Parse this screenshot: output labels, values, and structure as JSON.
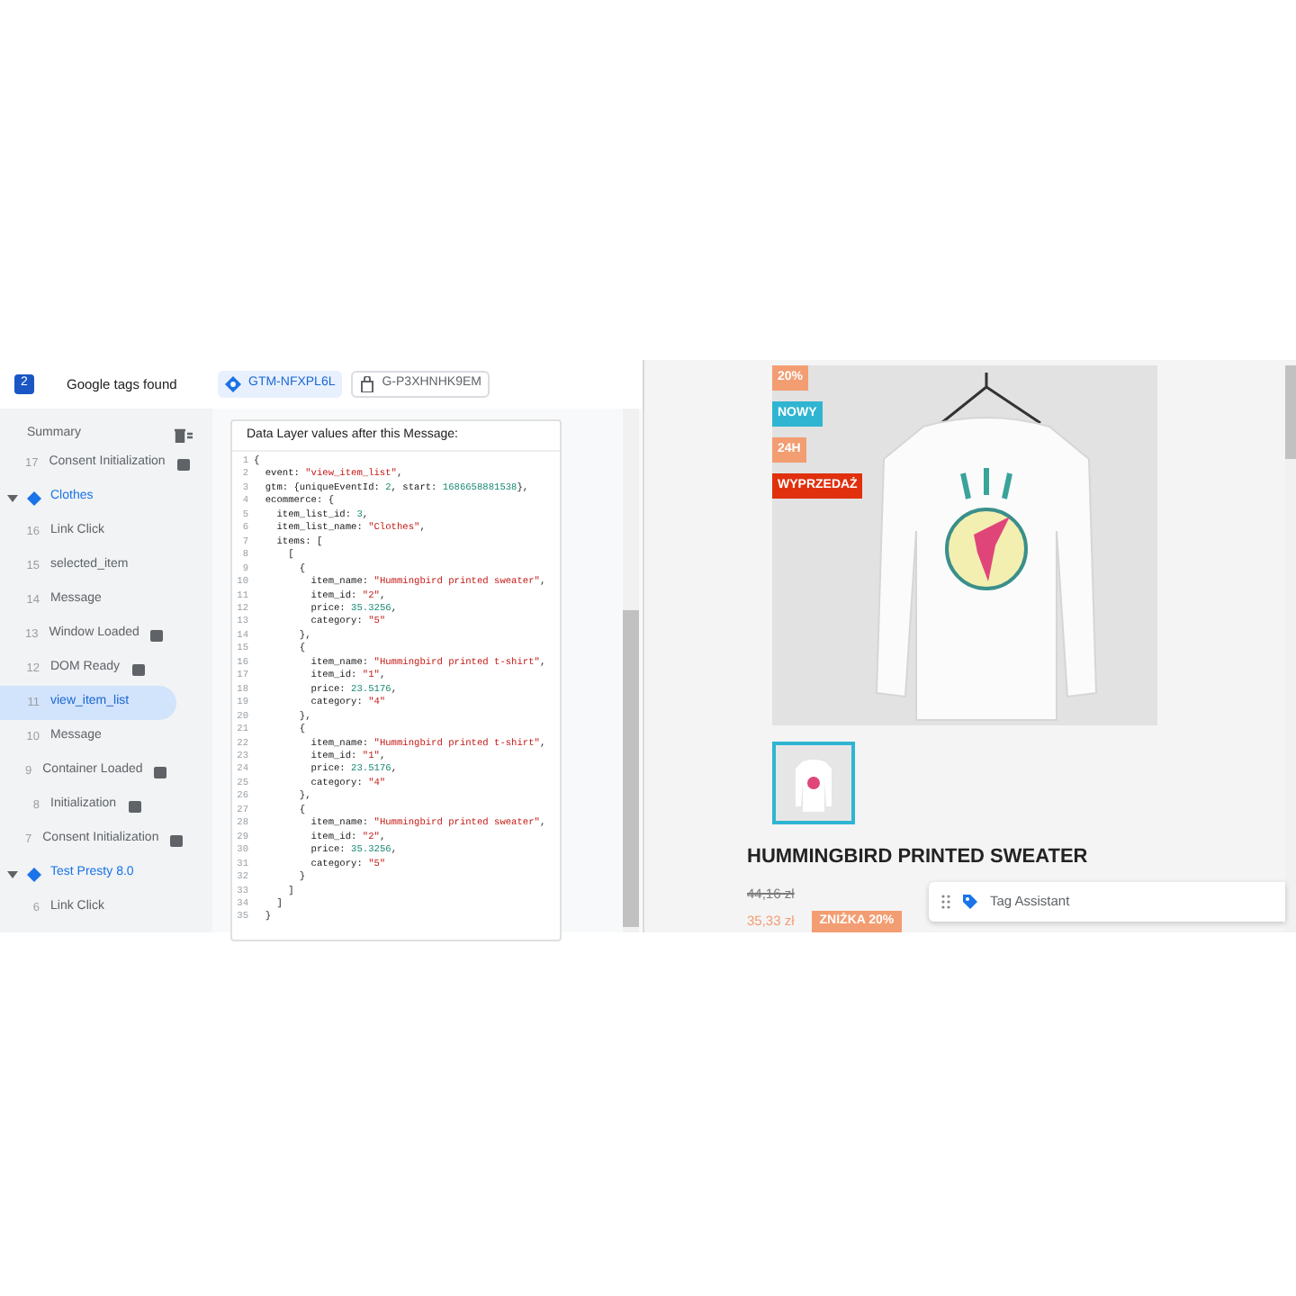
{
  "header": {
    "count": "2",
    "title": "Google tags found",
    "tabs": [
      {
        "label": "GTM-NFXPL6L",
        "kind": "gtm",
        "selected": true
      },
      {
        "label": "G-P3XHNHK9EM",
        "kind": "ga",
        "selected": false
      }
    ]
  },
  "sidebar": {
    "title": "Summary",
    "items": [
      {
        "kind": "event",
        "num": "17",
        "label": "Consent Initialization",
        "has_icon": true,
        "selected": false
      },
      {
        "kind": "page",
        "label": "Clothes",
        "expanded": true,
        "children": [
          {
            "kind": "event",
            "num": "16",
            "label": "Link Click",
            "has_icon": false,
            "selected": false
          },
          {
            "kind": "event",
            "num": "15",
            "label": "selected_item",
            "has_icon": false,
            "selected": false
          },
          {
            "kind": "event",
            "num": "14",
            "label": "Message",
            "has_icon": false,
            "selected": false
          },
          {
            "kind": "event",
            "num": "13",
            "label": "Window Loaded",
            "has_icon": true,
            "selected": false
          },
          {
            "kind": "event",
            "num": "12",
            "label": "DOM Ready",
            "has_icon": true,
            "selected": false
          },
          {
            "kind": "event",
            "num": "11",
            "label": "view_item_list",
            "has_icon": false,
            "selected": true
          },
          {
            "kind": "event",
            "num": "10",
            "label": "Message",
            "has_icon": false,
            "selected": false
          },
          {
            "kind": "event",
            "num": "9",
            "label": "Container Loaded",
            "has_icon": true,
            "selected": false
          },
          {
            "kind": "event",
            "num": "8",
            "label": "Initialization",
            "has_icon": true,
            "selected": false
          },
          {
            "kind": "event",
            "num": "7",
            "label": "Consent Initialization",
            "has_icon": true,
            "selected": false
          }
        ]
      },
      {
        "kind": "page",
        "label": "Test Presty 8.0",
        "expanded": true,
        "children": [
          {
            "kind": "event",
            "num": "6",
            "label": "Link Click",
            "has_icon": false,
            "selected": false
          }
        ]
      }
    ]
  },
  "data_layer": {
    "title": "Data Layer values after this Message:",
    "lines": [
      {
        "num": "1",
        "parts": [
          {
            "kind": "plain",
            "text": "{"
          }
        ]
      },
      {
        "num": "2",
        "parts": [
          {
            "kind": "plain",
            "text": "  event: "
          },
          {
            "kind": "string",
            "text": "\"view_item_list\""
          },
          {
            "kind": "plain",
            "text": ","
          }
        ]
      },
      {
        "num": "3",
        "parts": [
          {
            "kind": "plain",
            "text": "  gtm: {uniqueEventId: "
          },
          {
            "kind": "number",
            "text": "2"
          },
          {
            "kind": "plain",
            "text": ", start: "
          },
          {
            "kind": "number",
            "text": "1686658881538"
          },
          {
            "kind": "plain",
            "text": "},"
          }
        ]
      },
      {
        "num": "4",
        "parts": [
          {
            "kind": "plain",
            "text": "  ecommerce: {"
          }
        ]
      },
      {
        "num": "5",
        "parts": [
          {
            "kind": "plain",
            "text": "    item_list_id: "
          },
          {
            "kind": "number",
            "text": "3"
          },
          {
            "kind": "plain",
            "text": ","
          }
        ]
      },
      {
        "num": "6",
        "parts": [
          {
            "kind": "plain",
            "text": "    item_list_name: "
          },
          {
            "kind": "string",
            "text": "\"Clothes\""
          },
          {
            "kind": "plain",
            "text": ","
          }
        ]
      },
      {
        "num": "7",
        "parts": [
          {
            "kind": "plain",
            "text": "    items: ["
          }
        ]
      },
      {
        "num": "8",
        "parts": [
          {
            "kind": "plain",
            "text": "      ["
          }
        ]
      },
      {
        "num": "9",
        "parts": [
          {
            "kind": "plain",
            "text": "        {"
          }
        ]
      },
      {
        "num": "10",
        "parts": [
          {
            "kind": "plain",
            "text": "          item_name: "
          },
          {
            "kind": "string",
            "text": "\"Hummingbird printed sweater\""
          },
          {
            "kind": "plain",
            "text": ","
          }
        ]
      },
      {
        "num": "11",
        "parts": [
          {
            "kind": "plain",
            "text": "          item_id: "
          },
          {
            "kind": "string",
            "text": "\"2\""
          },
          {
            "kind": "plain",
            "text": ","
          }
        ]
      },
      {
        "num": "12",
        "parts": [
          {
            "kind": "plain",
            "text": "          price: "
          },
          {
            "kind": "number",
            "text": "35.3256"
          },
          {
            "kind": "plain",
            "text": ","
          }
        ]
      },
      {
        "num": "13",
        "parts": [
          {
            "kind": "plain",
            "text": "          category: "
          },
          {
            "kind": "string",
            "text": "\"5\""
          }
        ]
      },
      {
        "num": "14",
        "parts": [
          {
            "kind": "plain",
            "text": "        },"
          }
        ]
      },
      {
        "num": "15",
        "parts": [
          {
            "kind": "plain",
            "text": "        {"
          }
        ]
      },
      {
        "num": "16",
        "parts": [
          {
            "kind": "plain",
            "text": "          item_name: "
          },
          {
            "kind": "string",
            "text": "\"Hummingbird printed t-shirt\""
          },
          {
            "kind": "plain",
            "text": ","
          }
        ]
      },
      {
        "num": "17",
        "parts": [
          {
            "kind": "plain",
            "text": "          item_id: "
          },
          {
            "kind": "string",
            "text": "\"1\""
          },
          {
            "kind": "plain",
            "text": ","
          }
        ]
      },
      {
        "num": "18",
        "parts": [
          {
            "kind": "plain",
            "text": "          price: "
          },
          {
            "kind": "number",
            "text": "23.5176"
          },
          {
            "kind": "plain",
            "text": ","
          }
        ]
      },
      {
        "num": "19",
        "parts": [
          {
            "kind": "plain",
            "text": "          category: "
          },
          {
            "kind": "string",
            "text": "\"4\""
          }
        ]
      },
      {
        "num": "20",
        "parts": [
          {
            "kind": "plain",
            "text": "        },"
          }
        ]
      },
      {
        "num": "21",
        "parts": [
          {
            "kind": "plain",
            "text": "        {"
          }
        ]
      },
      {
        "num": "22",
        "parts": [
          {
            "kind": "plain",
            "text": "          item_name: "
          },
          {
            "kind": "string",
            "text": "\"Hummingbird printed t-shirt\""
          },
          {
            "kind": "plain",
            "text": ","
          }
        ]
      },
      {
        "num": "23",
        "parts": [
          {
            "kind": "plain",
            "text": "          item_id: "
          },
          {
            "kind": "string",
            "text": "\"1\""
          },
          {
            "kind": "plain",
            "text": ","
          }
        ]
      },
      {
        "num": "24",
        "parts": [
          {
            "kind": "plain",
            "text": "          price: "
          },
          {
            "kind": "number",
            "text": "23.5176"
          },
          {
            "kind": "plain",
            "text": ","
          }
        ]
      },
      {
        "num": "25",
        "parts": [
          {
            "kind": "plain",
            "text": "          category: "
          },
          {
            "kind": "string",
            "text": "\"4\""
          }
        ]
      },
      {
        "num": "26",
        "parts": [
          {
            "kind": "plain",
            "text": "        },"
          }
        ]
      },
      {
        "num": "27",
        "parts": [
          {
            "kind": "plain",
            "text": "        {"
          }
        ]
      },
      {
        "num": "28",
        "parts": [
          {
            "kind": "plain",
            "text": "          item_name: "
          },
          {
            "kind": "string",
            "text": "\"Hummingbird printed sweater\""
          },
          {
            "kind": "plain",
            "text": ","
          }
        ]
      },
      {
        "num": "29",
        "parts": [
          {
            "kind": "plain",
            "text": "          item_id: "
          },
          {
            "kind": "string",
            "text": "\"2\""
          },
          {
            "kind": "plain",
            "text": ","
          }
        ]
      },
      {
        "num": "30",
        "parts": [
          {
            "kind": "plain",
            "text": "          price: "
          },
          {
            "kind": "number",
            "text": "35.3256"
          },
          {
            "kind": "plain",
            "text": ","
          }
        ]
      },
      {
        "num": "31",
        "parts": [
          {
            "kind": "plain",
            "text": "          category: "
          },
          {
            "kind": "string",
            "text": "\"5\""
          }
        ]
      },
      {
        "num": "32",
        "parts": [
          {
            "kind": "plain",
            "text": "        }"
          }
        ]
      },
      {
        "num": "33",
        "parts": [
          {
            "kind": "plain",
            "text": "      ]"
          }
        ]
      },
      {
        "num": "34",
        "parts": [
          {
            "kind": "plain",
            "text": "    ]"
          }
        ]
      },
      {
        "num": "35",
        "parts": [
          {
            "kind": "plain",
            "text": "  }"
          }
        ]
      }
    ]
  },
  "product": {
    "badges": [
      {
        "label": "20%",
        "color": "#f39d72"
      },
      {
        "label": "NOWY",
        "color": "#2fb5d2"
      },
      {
        "label": "24H",
        "color": "#f39d72"
      },
      {
        "label": "WYPRZEDAŻ",
        "color": "#e0300e"
      }
    ],
    "title": "HUMMINGBIRD PRINTED SWEATER",
    "old_price": "44,16 zł",
    "price": "35,33 zł",
    "discount": "ZNIŻKA 20%"
  },
  "widget": {
    "title": "Tag Assistant"
  }
}
